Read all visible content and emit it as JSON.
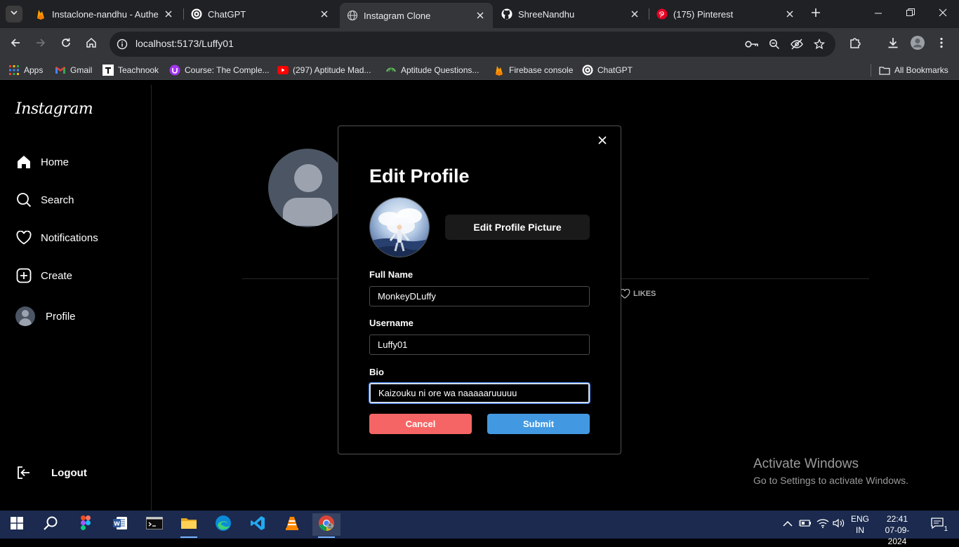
{
  "browser": {
    "tabs": [
      {
        "title": "Instaclone-nandhu - Authen",
        "icon": "firebase-icon"
      },
      {
        "title": "ChatGPT",
        "icon": "chatgpt-icon"
      },
      {
        "title": "Instagram Clone",
        "icon": "globe-icon"
      },
      {
        "title": "ShreeNandhu",
        "icon": "github-icon"
      },
      {
        "title": "(175) Pinterest",
        "icon": "pinterest-icon"
      }
    ],
    "active_tab_index": 2,
    "url": "localhost:5173/Luffy01",
    "bookmarks": [
      {
        "label": "Apps",
        "icon": "apps-grid-icon"
      },
      {
        "label": "Gmail",
        "icon": "gmail-icon"
      },
      {
        "label": "Teachnook",
        "icon": "teachnook-icon"
      },
      {
        "label": "Course: The Comple...",
        "icon": "course-icon"
      },
      {
        "label": "(297) Aptitude Mad...",
        "icon": "youtube-icon"
      },
      {
        "label": "Aptitude Questions...",
        "icon": "aptitude-icon"
      },
      {
        "label": "Firebase console",
        "icon": "firebase-icon"
      },
      {
        "label": "ChatGPT",
        "icon": "chatgpt-icon"
      }
    ],
    "all_bookmarks_label": "All Bookmarks"
  },
  "sidebar": {
    "logo": "Instagram",
    "items": [
      {
        "label": "Home",
        "icon": "home-icon"
      },
      {
        "label": "Search",
        "icon": "search-icon"
      },
      {
        "label": "Notifications",
        "icon": "heart-icon"
      },
      {
        "label": "Create",
        "icon": "plus-square-icon"
      },
      {
        "label": "Profile",
        "icon": "avatar"
      }
    ],
    "logout_label": "Logout"
  },
  "profile_page": {
    "likes_tab_label": "LIKES"
  },
  "modal": {
    "title": "Edit Profile",
    "edit_picture_label": "Edit Profile Picture",
    "full_name_label": "Full Name",
    "full_name_value": "MonkeyDLuffy",
    "username_label": "Username",
    "username_value": "Luffy01",
    "bio_label": "Bio",
    "bio_value": "Kaizouku ni ore wa naaaaaruuuuu",
    "cancel_label": "Cancel",
    "submit_label": "Submit"
  },
  "watermark": {
    "line1": "Activate Windows",
    "line2": "Go to Settings to activate Windows."
  },
  "taskbar": {
    "lang_line1": "ENG",
    "lang_line2": "IN",
    "time": "22:41",
    "date": "07-09-2024",
    "notification_count": "1"
  },
  "colors": {
    "cancel": "#f56565",
    "submit": "#4299e1",
    "browser_bg": "#202124",
    "toolbar_bg": "#35363a"
  }
}
